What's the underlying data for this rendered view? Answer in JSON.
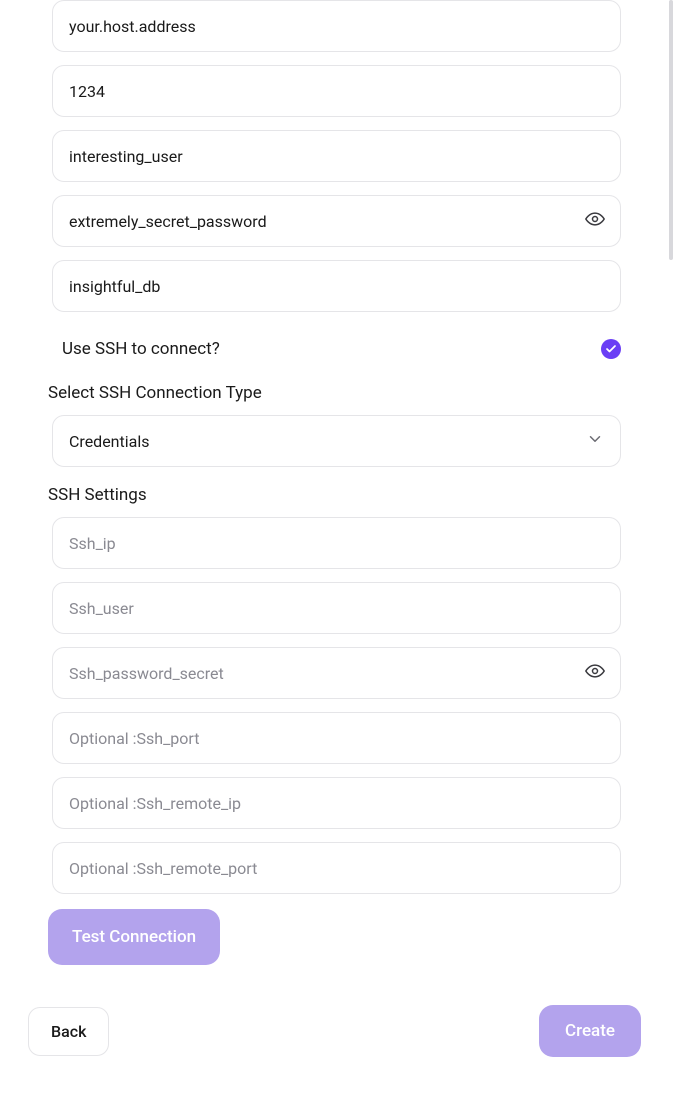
{
  "connection": {
    "host": "your.host.address",
    "port": "1234",
    "user": "interesting_user",
    "password": "extremely_secret_password",
    "database": "insightful_db"
  },
  "ssh": {
    "toggle_label": "Use SSH to connect?",
    "section_type_label": "Select SSH Connection Type",
    "type_selected": "Credentials",
    "settings_label": "SSH Settings",
    "placeholders": {
      "ip": "Ssh_ip",
      "user": "Ssh_user",
      "password": "Ssh_password_secret",
      "port": "Optional :Ssh_port",
      "remote_ip": "Optional :Ssh_remote_ip",
      "remote_port": "Optional :Ssh_remote_port"
    }
  },
  "buttons": {
    "test": "Test Connection",
    "back": "Back",
    "create": "Create"
  }
}
